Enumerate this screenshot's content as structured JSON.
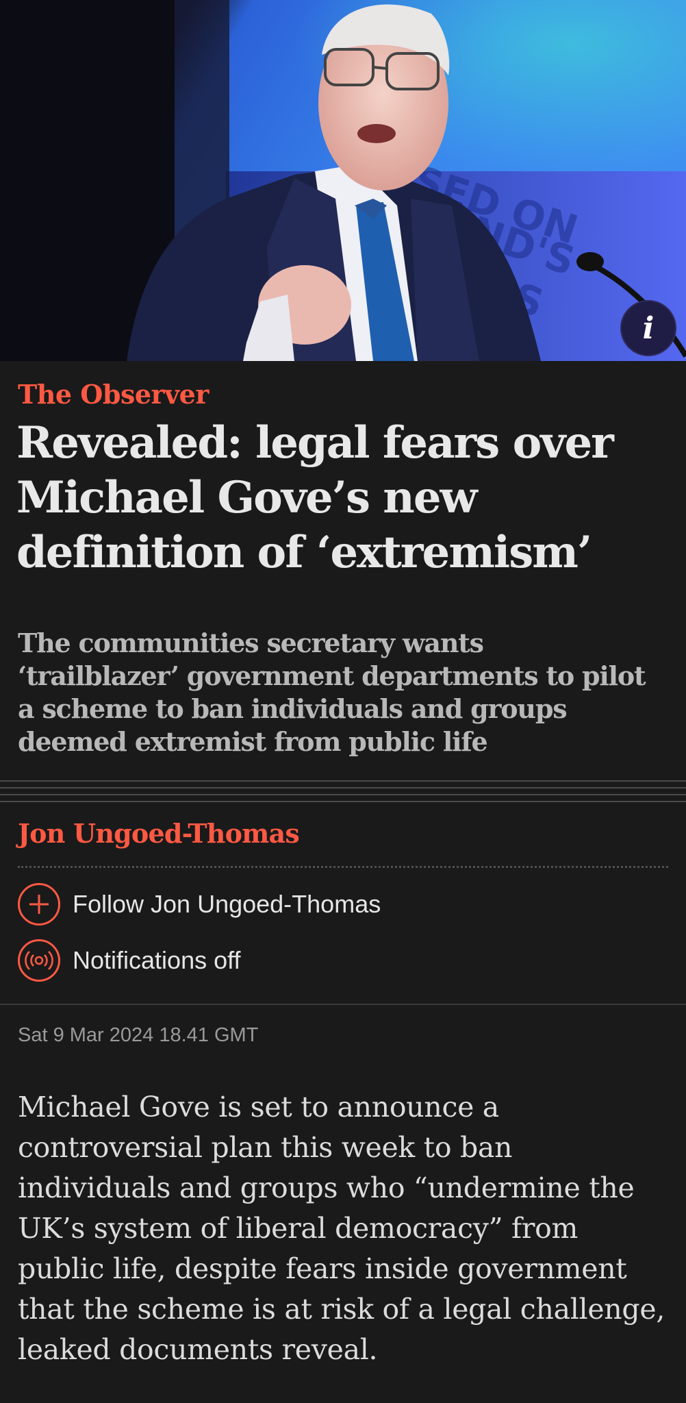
{
  "hero": {
    "image_alt": "Photo of Michael Gove speaking at a lectern",
    "info_icon": "info-icon",
    "info_label": "i"
  },
  "article": {
    "kicker": "The Observer",
    "headline_lines": [
      "Revealed: legal fears over",
      "Michael Gove’s new",
      "definition of ‘extremism’"
    ],
    "standfirst_lines": [
      "The communities secretary wants",
      "‘trailblazer’ government departments to pilot",
      "a scheme to ban individuals and groups",
      "deemed extremist from public life"
    ],
    "byline": "Jon Ungoed-Thomas",
    "follow_label": "Follow Jon Ungoed-Thomas",
    "follow_icon": "plus-circle-icon",
    "notifications_label": "Notifications off",
    "notifications_icon": "broadcast-icon",
    "date": "Sat 9 Mar 2024 18.41 GMT",
    "body_lines": [
      "Michael Gove is set to announce a",
      "controversial plan this week to ban",
      "individuals and groups who “undermine the",
      "UK’s system of liberal democracy” from",
      "public life, despite fears inside government",
      "that the scheme is at risk of a legal challenge,",
      "leaked documents reveal."
    ]
  },
  "colors": {
    "background": "#1a1a1a",
    "accent": "#ff5943",
    "headline": "#e8e8e8",
    "standfirst": "#b8b8b8",
    "meta": "#9a9a9a"
  }
}
